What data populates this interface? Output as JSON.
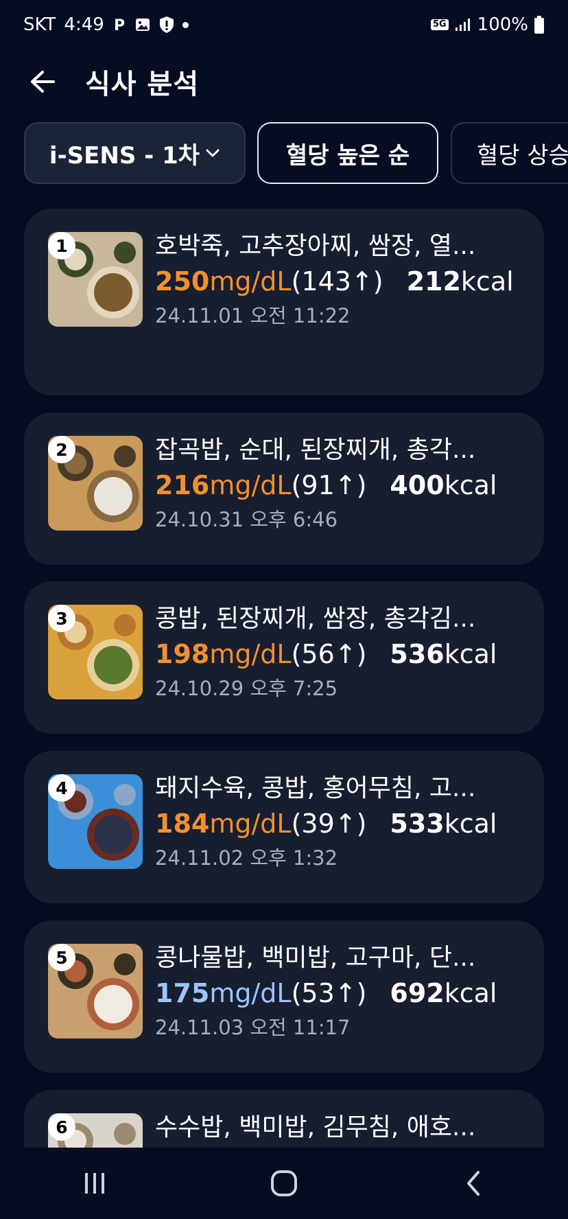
{
  "status_bar": {
    "carrier": "SKT",
    "time": "4:49",
    "notif_icons": [
      "parking-icon",
      "gallery-icon",
      "shield-icon",
      "dot-icon"
    ],
    "network": "5G",
    "battery": "100%"
  },
  "app_bar": {
    "title": "식사 분석"
  },
  "filters": {
    "device": "i-SENS - 1차",
    "sort_primary": "혈당 높은 순",
    "sort_secondary": "혈당 상승"
  },
  "meals": [
    {
      "rank": "1",
      "name": "호박죽, 고추장아찌, 쌈장, 열...",
      "glucose": "250",
      "unit": "mg/dL",
      "rise": "(143↑)",
      "kcal": "212",
      "kcal_unit": "kcal",
      "datetime": "24.11.01 오전 11:22",
      "level": "high",
      "thumb_colors": [
        "#c8b79a",
        "#7b5b2e",
        "#3d4a2a",
        "#e2d6bf"
      ]
    },
    {
      "rank": "2",
      "name": "잡곡밥, 순대, 된장찌개, 총각...",
      "glucose": "216",
      "unit": "mg/dL",
      "rise": "(91↑)",
      "kcal": "400",
      "kcal_unit": "kcal",
      "datetime": "24.10.31 오후 6:46",
      "level": "high",
      "thumb_colors": [
        "#c99a5a",
        "#e9e4dc",
        "#4a3a28",
        "#8a6a3e"
      ]
    },
    {
      "rank": "3",
      "name": "콩밥, 된장찌개, 쌈장, 총각김...",
      "glucose": "198",
      "unit": "mg/dL",
      "rise": "(56↑)",
      "kcal": "536",
      "kcal_unit": "kcal",
      "datetime": "24.10.29 오후 7:25",
      "level": "high",
      "thumb_colors": [
        "#d9a23c",
        "#5a7a2c",
        "#b6762e",
        "#e7cf9a"
      ]
    },
    {
      "rank": "4",
      "name": "돼지수육, 콩밥, 홍어무침, 고...",
      "glucose": "184",
      "unit": "mg/dL",
      "rise": "(39↑)",
      "kcal": "533",
      "kcal_unit": "kcal",
      "datetime": "24.11.02 오후 1:32",
      "level": "high",
      "thumb_colors": [
        "#3a8fd8",
        "#2a3148",
        "#8aa6c8",
        "#6a2a22"
      ]
    },
    {
      "rank": "5",
      "name": "콩나물밥, 백미밥, 고구마, 단...",
      "glucose": "175",
      "unit": "mg/dL",
      "rise": "(53↑)",
      "kcal": "692",
      "kcal_unit": "kcal",
      "datetime": "24.11.03 오전 11:17",
      "level": "mid",
      "thumb_colors": [
        "#c8a070",
        "#efeae2",
        "#3a3020",
        "#b0603a"
      ]
    },
    {
      "rank": "6",
      "name": "수수밥, 백미밥, 김무침, 애호...",
      "glucose": "",
      "unit": "",
      "rise": "",
      "kcal": "",
      "kcal_unit": "",
      "datetime": "",
      "level": "high",
      "thumb_colors": [
        "#d8d4cc",
        "#3a5a2a",
        "#9a8a70",
        "#e8e2d8"
      ]
    }
  ],
  "colors": {
    "background": "#060c22",
    "card": "#161e30",
    "glucose_high": "#f4902c",
    "glucose_mid": "#9ec3ff"
  },
  "nav": {
    "recents": "recents-icon",
    "home": "home-icon",
    "back": "back-icon"
  }
}
